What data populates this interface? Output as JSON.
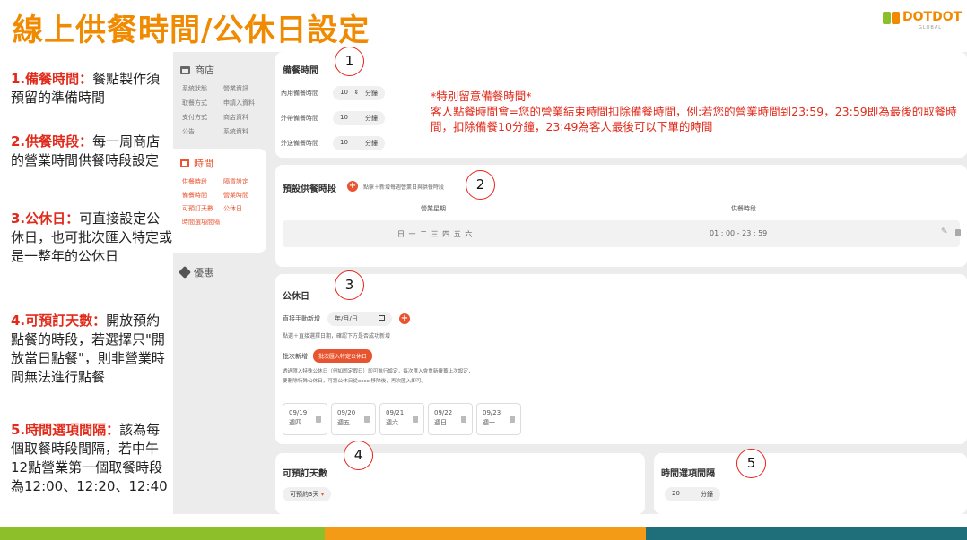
{
  "slide": {
    "title": "線上供餐時間/公休日設定",
    "logo_word": "DOTDOT",
    "logo_sub": "GLOBAL"
  },
  "notes": [
    {
      "head": "1.備餐時間：",
      "body": "餐點製作須預留的準備時間"
    },
    {
      "head": "2.供餐時段：",
      "body": "每一周商店的營業時間供餐時段設定"
    },
    {
      "head": "3.公休日：",
      "body": "可直接設定公休日，也可批次匯入特定或是一整年的公休日"
    },
    {
      "head": "4.可預訂天數：",
      "body": "開放預約點餐的時段，若選擇只\"開放當日點餐\"，則非營業時間無法進行點餐"
    },
    {
      "head": "5.時間選項間隔：",
      "body": "該為每個取餐時段間隔，若中午12點營業第一個取餐時段為12:00、12:20、12:40"
    }
  ],
  "sidebar": {
    "store_label": "商店",
    "store_items": [
      "系統狀態",
      "營業資訊",
      "取餐方式",
      "申請入資料",
      "支付方式",
      "商店資料",
      "公告",
      "系統資料"
    ],
    "time_label": "時間",
    "time_items": [
      "供餐時段",
      "隔貨設定",
      "備餐時間",
      "營業時間",
      "可預訂天數",
      "公休日",
      "時間選項間隔"
    ],
    "promo_label": "優惠"
  },
  "prep": {
    "title": "備餐時間",
    "rows": [
      {
        "label": "內用備餐時間",
        "value": "10",
        "unit": "分鐘",
        "stepper": true
      },
      {
        "label": "外帶備餐時間",
        "value": "10",
        "unit": "分鐘",
        "stepper": false
      },
      {
        "label": "外送備餐時間",
        "value": "10",
        "unit": "分鐘",
        "stepper": false
      }
    ]
  },
  "alert": {
    "line1": "*特別留意備餐時間*",
    "line2": "客人點餐時間會=您的營業結束時間扣除備餐時間，例:若您的營業時間到23:59，23:59即為最後的取餐時間，扣除備餐10分鐘，23:49為客人最後可以下單的時間"
  },
  "slots": {
    "title": "預設供餐時段",
    "hint": "點擊＋新增每週營業日與供餐時段",
    "col_day": "營業星期",
    "col_time": "供餐時段",
    "row_days": "日 一 二 三 四 五 六",
    "row_time": "01 : 00 - 23 : 59"
  },
  "holiday": {
    "title": "公休日",
    "direct_label": "直接手動新增",
    "date_placeholder": "年/月/日",
    "direct_hint": "點選＋直接選擇日期，確認下方是否成功新增",
    "batch_label": "批次新增",
    "batch_button": "批次匯入特定公休日",
    "batch_hint1": "透過匯入特殊公休日（例如固定假日）即可進行設定，每次匯入會重新覆蓋上次設定，",
    "batch_hint2": "要刪除特殊公休日，可將公休日從excel移除後，再次匯入即可。",
    "dates": [
      {
        "date": "09/19",
        "weekday": "週四"
      },
      {
        "date": "09/20",
        "weekday": "週五"
      },
      {
        "date": "09/21",
        "weekday": "週六"
      },
      {
        "date": "09/22",
        "weekday": "週日"
      },
      {
        "date": "09/23",
        "weekday": "週一"
      }
    ]
  },
  "advance": {
    "title": "可預訂天數",
    "value": "可預約3天"
  },
  "interval": {
    "title": "時間選項間隔",
    "value": "20",
    "unit": "分鐘"
  },
  "markers": [
    "1",
    "2",
    "3",
    "4",
    "5"
  ],
  "colors": {
    "title": "#f08a00",
    "accent": "#e8542f",
    "alert": "#e12a1a",
    "stripe_green": "#8dbf2a",
    "stripe_orange": "#f39a16",
    "stripe_teal": "#1f6f7a"
  }
}
